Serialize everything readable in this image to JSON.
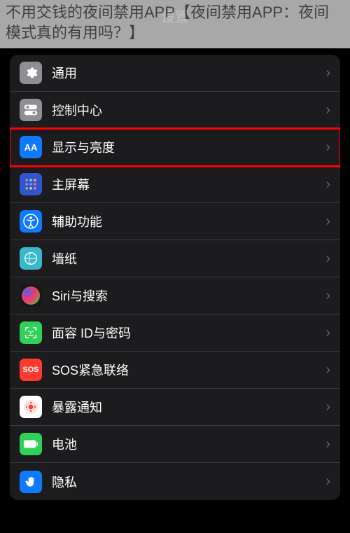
{
  "overlay_text": "不用交钱的夜间禁用APP【夜间禁用APP：夜间模式真的有用吗？】",
  "header_title": "设置",
  "rows": [
    {
      "label": "通用",
      "icon": "general"
    },
    {
      "label": "控制中心",
      "icon": "control-center"
    },
    {
      "label": "显示与亮度",
      "icon": "display",
      "highlighted": true
    },
    {
      "label": "主屏幕",
      "icon": "home-screen"
    },
    {
      "label": "辅助功能",
      "icon": "accessibility"
    },
    {
      "label": "墙纸",
      "icon": "wallpaper"
    },
    {
      "label": "Siri与搜索",
      "icon": "siri"
    },
    {
      "label": "面容 ID与密码",
      "icon": "face-id"
    },
    {
      "label": "SOS紧急联络",
      "icon": "sos"
    },
    {
      "label": "暴露通知",
      "icon": "exposure"
    },
    {
      "label": "电池",
      "icon": "battery"
    },
    {
      "label": "隐私",
      "icon": "privacy"
    }
  ],
  "display_icon_text": "AA",
  "sos_icon_text": "SOS"
}
